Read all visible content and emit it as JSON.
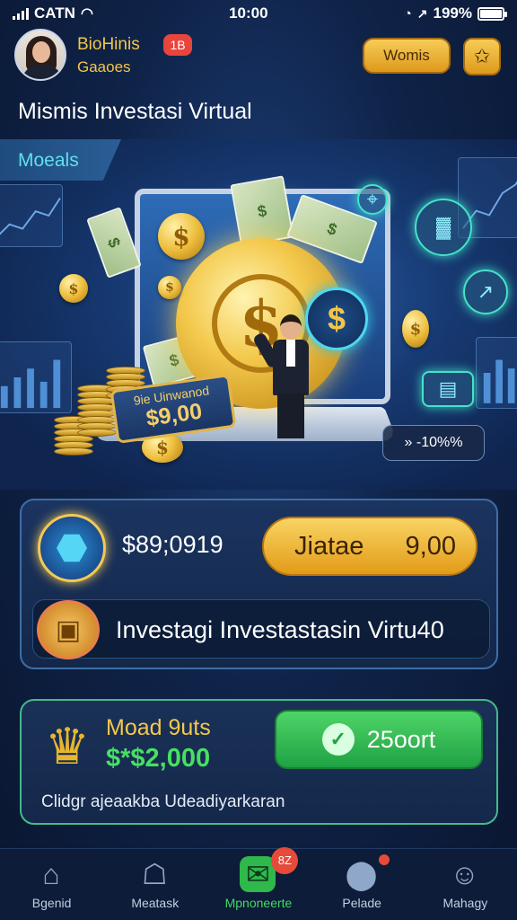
{
  "status_bar": {
    "carrier": "CATN",
    "time": "10:00",
    "battery": "199%"
  },
  "header": {
    "user_name": "BioHinis",
    "user_sub": "Gaaoes",
    "notification_count": "1B",
    "action_button": "Womis",
    "star_icon": "star-icon"
  },
  "page_title": "Mismis Investasi Virtual",
  "hero": {
    "section_tab": "Moeals",
    "tag_line1": "9ie Uinwanod",
    "tag_line2": "$9,00",
    "blue_coin_symbol": "$",
    "big_coin_symbol": "$",
    "bill_symbol": "$",
    "chip_text": "» -10%%"
  },
  "balance_card": {
    "balance": "$89;0919",
    "pill_label": "Jiatae",
    "pill_value": "9,00",
    "invest_label": "Investagi Investastasin Virtu40"
  },
  "reward_card": {
    "title": "Moad 9uts",
    "amount": "$*$2,000",
    "button_label": "25oort",
    "note": "Clidgr ajeaakba Udeadiyarkaran"
  },
  "bottom_nav": [
    {
      "label": "Bgenid",
      "icon": "home-icon",
      "badge": ""
    },
    {
      "label": "Meatask",
      "icon": "house-icon",
      "badge": ""
    },
    {
      "label": "Mpnoneerte",
      "icon": "chat-icon",
      "badge": "8Z"
    },
    {
      "label": "Pelade",
      "icon": "gamepad-icon",
      "badge": ""
    },
    {
      "label": "Mahagy",
      "icon": "profile-icon",
      "badge": ""
    }
  ],
  "colors": {
    "gold": "#f2c64a",
    "green": "#2fb84c",
    "cyan": "#5fe0ee",
    "background": "#0f2348"
  }
}
